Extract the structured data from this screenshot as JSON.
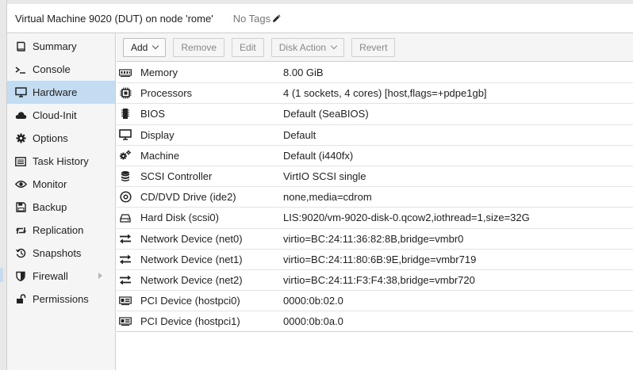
{
  "header": {
    "title": "Virtual Machine 9020 (DUT) on node 'rome'",
    "tags_label": "No Tags",
    "tags_icon": "pencil-icon"
  },
  "sidebar": {
    "items": [
      {
        "label": "Summary",
        "icon": "book-icon",
        "active": false
      },
      {
        "label": "Console",
        "icon": "terminal-icon",
        "active": false
      },
      {
        "label": "Hardware",
        "icon": "desktop-icon",
        "active": true
      },
      {
        "label": "Cloud-Init",
        "icon": "cloud-icon",
        "active": false
      },
      {
        "label": "Options",
        "icon": "gear-icon",
        "active": false
      },
      {
        "label": "Task History",
        "icon": "list-icon",
        "active": false
      },
      {
        "label": "Monitor",
        "icon": "eye-icon",
        "active": false
      },
      {
        "label": "Backup",
        "icon": "floppy-icon",
        "active": false
      },
      {
        "label": "Replication",
        "icon": "retweet-icon",
        "active": false
      },
      {
        "label": "Snapshots",
        "icon": "history-icon",
        "active": false
      },
      {
        "label": "Firewall",
        "icon": "shield-icon",
        "active": false,
        "expandable": true
      },
      {
        "label": "Permissions",
        "icon": "unlock-icon",
        "active": false
      }
    ]
  },
  "toolbar": {
    "add_label": "Add",
    "remove_label": "Remove",
    "edit_label": "Edit",
    "disk_action_label": "Disk Action",
    "revert_label": "Revert"
  },
  "hardware": {
    "rows": [
      {
        "icon": "memory-icon",
        "name": "Memory",
        "value": "8.00 GiB"
      },
      {
        "icon": "cpu-icon",
        "name": "Processors",
        "value": "4 (1 sockets, 4 cores) [host,flags=+pdpe1gb]"
      },
      {
        "icon": "microchip-icon",
        "name": "BIOS",
        "value": "Default (SeaBIOS)"
      },
      {
        "icon": "monitor-icon",
        "name": "Display",
        "value": "Default"
      },
      {
        "icon": "cogs-icon",
        "name": "Machine",
        "value": "Default (i440fx)"
      },
      {
        "icon": "database-icon",
        "name": "SCSI Controller",
        "value": "VirtIO SCSI single"
      },
      {
        "icon": "cdrom-icon",
        "name": "CD/DVD Drive (ide2)",
        "value": "none,media=cdrom"
      },
      {
        "icon": "hdd-icon",
        "name": "Hard Disk (scsi0)",
        "value": "LIS:9020/vm-9020-disk-0.qcow2,iothread=1,size=32G"
      },
      {
        "icon": "exchange-icon",
        "name": "Network Device (net0)",
        "value": "virtio=BC:24:11:36:82:8B,bridge=vmbr0"
      },
      {
        "icon": "exchange-icon",
        "name": "Network Device (net1)",
        "value": "virtio=BC:24:11:80:6B:9E,bridge=vmbr719"
      },
      {
        "icon": "exchange-icon",
        "name": "Network Device (net2)",
        "value": "virtio=BC:24:11:F3:F4:38,bridge=vmbr720"
      },
      {
        "icon": "pci-card-icon",
        "name": "PCI Device (hostpci0)",
        "value": "0000:0b:02.0"
      },
      {
        "icon": "pci-card-icon",
        "name": "PCI Device (hostpci1)",
        "value": "0000:0b:0a.0"
      }
    ]
  },
  "colors": {
    "selection": "#c4dcf2",
    "border": "#cfcfcf",
    "panel_bg": "#f5f5f5"
  }
}
